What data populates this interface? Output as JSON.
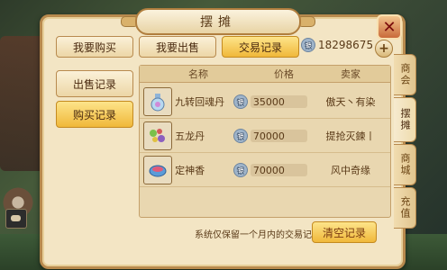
{
  "window": {
    "title": "摆摊"
  },
  "top_tabs": [
    {
      "label": "我要购买"
    },
    {
      "label": "我要出售"
    },
    {
      "label": "交易记录"
    }
  ],
  "currency": {
    "amount": "18298675"
  },
  "left_menu": [
    {
      "label": "出售记录"
    },
    {
      "label": "购买记录"
    }
  ],
  "table": {
    "headers": {
      "name": "名称",
      "price": "价格",
      "seller": "卖家"
    },
    "rows": [
      {
        "name": "九转回魂丹",
        "price": "35000",
        "seller": "傲天丶有染",
        "icon": "potion-bottle-icon"
      },
      {
        "name": "五龙丹",
        "price": "70000",
        "seller": "提抢灭鍊丨",
        "icon": "pills-icon"
      },
      {
        "name": "定神香",
        "price": "70000",
        "seller": "风中奇缘",
        "icon": "incense-bowl-icon"
      }
    ]
  },
  "side_tabs": [
    {
      "label": "商会"
    },
    {
      "label": "摆摊"
    },
    {
      "label": "商城"
    },
    {
      "label": "充值"
    }
  ],
  "footer": {
    "note": "系统仅保留一个月内的交易记录",
    "clear_label": "清空记录"
  },
  "colors": {
    "accent": "#f0b83a",
    "panel": "#f3e5c4",
    "border": "#b88a4e"
  }
}
